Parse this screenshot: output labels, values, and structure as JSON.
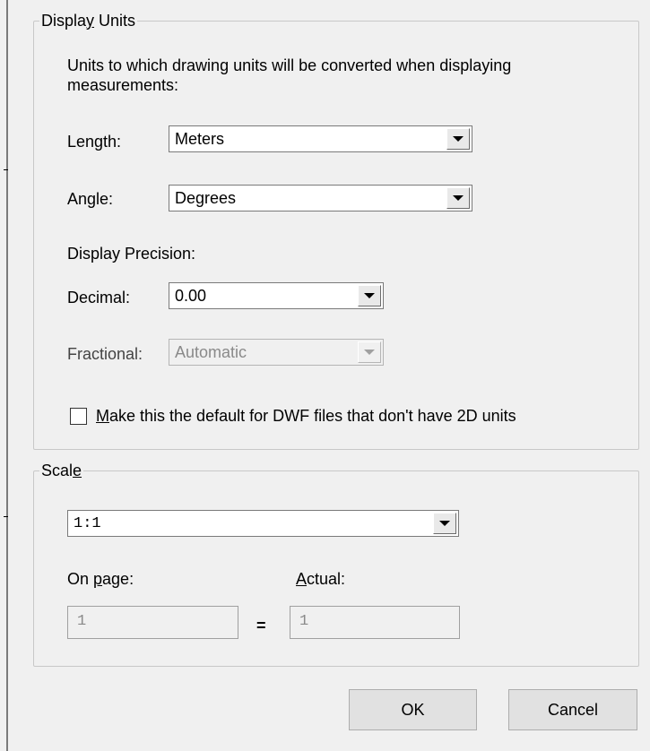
{
  "display_units": {
    "title_pre": "Displa",
    "title_mnemonic": "y",
    "title_post": " Units",
    "description": "Units to which drawing units will be converted when displaying measurements:",
    "length_label": "Length:",
    "length_value": "Meters",
    "angle_label": "Angle:",
    "angle_value": "Degrees",
    "precision_heading": "Display Precision:",
    "decimal_label": "Decimal:",
    "decimal_value": "0.00",
    "fractional_label": "Fractional:",
    "fractional_value": "Automatic",
    "fractional_enabled": false,
    "default_checkbox_mnemonic": "M",
    "default_checkbox_text": "ake this the default for DWF files that don't have 2D units",
    "default_checkbox_checked": false
  },
  "scale": {
    "title_pre": "Scal",
    "title_mnemonic": "e",
    "value": "1:1",
    "on_page_pre": "On ",
    "on_page_mnemonic": "p",
    "on_page_post": "age:",
    "actual_mnemonic": "A",
    "actual_post": "ctual:",
    "on_page_value": "1",
    "equals": "=",
    "actual_value": "1"
  },
  "buttons": {
    "ok": "OK",
    "cancel": "Cancel"
  },
  "icons": {
    "dropdown": "chevron-down-icon"
  }
}
